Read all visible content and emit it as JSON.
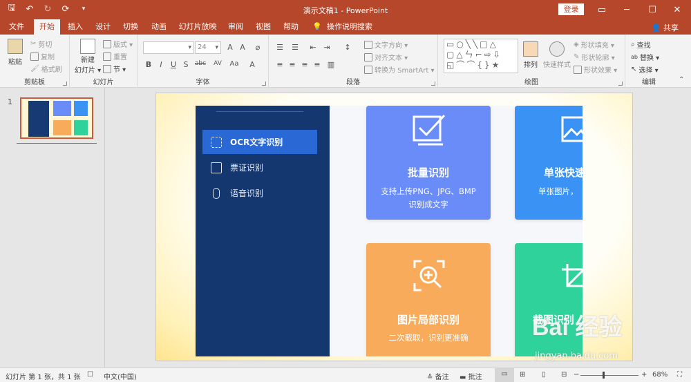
{
  "titlebar": {
    "title": "演示文稿1  -  PowerPoint",
    "login": "登录",
    "qat": [
      "save-icon",
      "undo-icon",
      "redo-icon",
      "start-from-beginning-icon",
      "customize-icon"
    ],
    "qat_glyphs": [
      "🖫",
      "↶",
      "↻",
      "⟳",
      "▾"
    ],
    "controls": [
      "▭",
      "─",
      "☐",
      "✕"
    ]
  },
  "tabs": [
    "文件",
    "开始",
    "插入",
    "设计",
    "切换",
    "动画",
    "幻灯片放映",
    "审阅",
    "视图",
    "帮助",
    "操作说明搜索"
  ],
  "share": "共享",
  "ribbon": {
    "clipboard": {
      "label": "剪贴板",
      "paste": "粘贴",
      "cut": "剪切",
      "copy": "复制",
      "format_painter": "格式刷"
    },
    "slides": {
      "label": "幻灯片",
      "new_slide": "新建",
      "new_slide2": "幻灯片 ▾",
      "layout": "版式 ▾",
      "reset": "重置",
      "section": "节 ▾"
    },
    "font": {
      "label": "字体",
      "font_name": "",
      "font_size": "24",
      "bold": "B",
      "italic": "I",
      "underline": "U",
      "strike": "S",
      "shadow": "abc",
      "spacing": "AV",
      "case": "Aa",
      "color": "A",
      "highlight": "A"
    },
    "paragraph": {
      "label": "段落",
      "text_direction": "文字方向 ▾",
      "align_text": "对齐文本 ▾",
      "smartart": "转换为 SmartArt ▾"
    },
    "drawing": {
      "label": "绘图",
      "arrange": "排列",
      "quick_styles": "快速样式",
      "shape_fill": "形状填充 ▾",
      "shape_outline": "形状轮廓 ▾",
      "shape_effects": "形状效果 ▾"
    },
    "editing": {
      "label": "编辑",
      "find": "查找",
      "replace": "替换 ▾",
      "select": "选择 ▾"
    }
  },
  "thumbnail": {
    "number": "1"
  },
  "slide_app": {
    "menu": [
      {
        "label": "OCR文字识别",
        "icon": "ocr-scan-icon"
      },
      {
        "label": "票证识别",
        "icon": "ticket-icon"
      },
      {
        "label": "语音识别",
        "icon": "microphone-icon"
      }
    ],
    "cards": [
      {
        "title": "批量识别",
        "desc1": "支持上传PNG、JPG、BMP",
        "desc2": "识别成文字",
        "color": "#6a8cf8"
      },
      {
        "title": "单张快速",
        "desc1": "单张图片，",
        "desc2": "",
        "color": "#3a92f5"
      },
      {
        "title": "图片局部识别",
        "desc1": "二次截取，识别更准确",
        "desc2": "",
        "color": "#f9ab5c"
      },
      {
        "title": "截图识别",
        "desc1": "",
        "desc2": "",
        "color": "#2fd29b"
      }
    ]
  },
  "watermark": {
    "logo": "Bai 经验",
    "site": "jingyan.baidu.com"
  },
  "statusbar": {
    "slide_info": "幻灯片 第 1 张，共 1 张",
    "language": "中文(中国)",
    "notes": "备注",
    "comments": "批注",
    "zoom_minus": "−",
    "zoom_plus": "+",
    "zoom_percent": "68%"
  }
}
